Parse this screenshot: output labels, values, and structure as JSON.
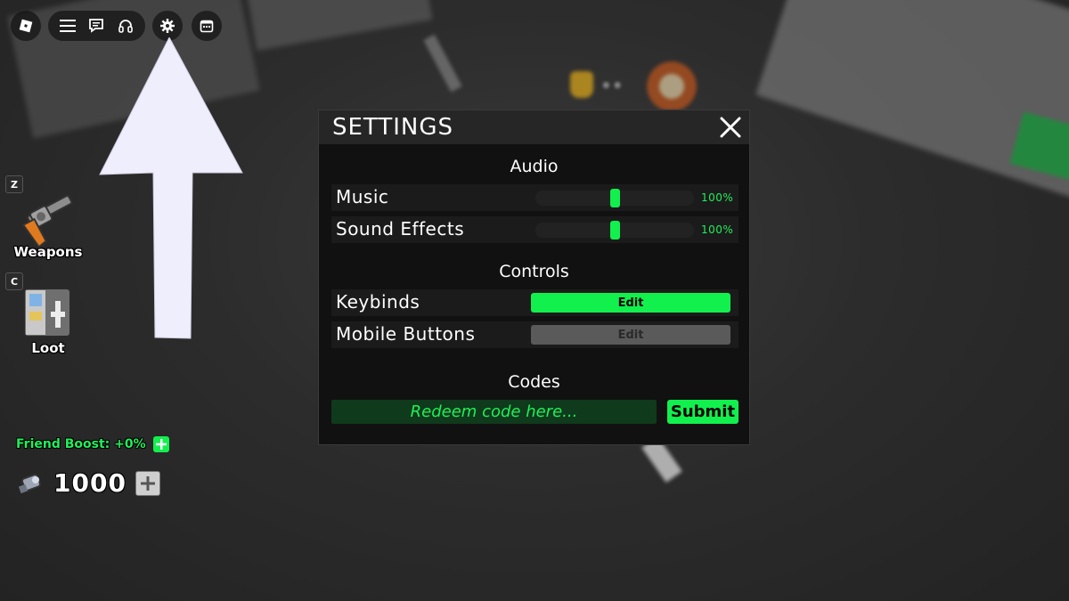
{
  "colors": {
    "accent_green": "#12f04d",
    "panel_bg": "#111111",
    "header_bg": "#262626",
    "disabled_gray": "#5a5a5a"
  },
  "topbar": {
    "icons": [
      "roblox-logo-icon",
      "menu-icon",
      "chat-icon",
      "headset-icon",
      "gear-icon",
      "calendar-icon"
    ]
  },
  "hud": {
    "weapons": {
      "hotkey": "Z",
      "label": "Weapons"
    },
    "loot": {
      "hotkey": "C",
      "label": "Loot"
    },
    "friend_boost": "Friend Boost: +0%",
    "currency_value": "1000"
  },
  "settings": {
    "title": "SETTINGS",
    "audio": {
      "heading": "Audio",
      "music": {
        "label": "Music",
        "value_text": "100%",
        "level": 0.5
      },
      "sound_effects": {
        "label": "Sound Effects",
        "value_text": "100%",
        "level": 0.5
      }
    },
    "controls": {
      "heading": "Controls",
      "keybinds": {
        "label": "Keybinds",
        "button": "Edit"
      },
      "mobile_buttons": {
        "label": "Mobile Buttons",
        "button": "Edit"
      }
    },
    "codes": {
      "heading": "Codes",
      "placeholder": "Redeem code here...",
      "value": "",
      "submit": "Submit"
    }
  }
}
